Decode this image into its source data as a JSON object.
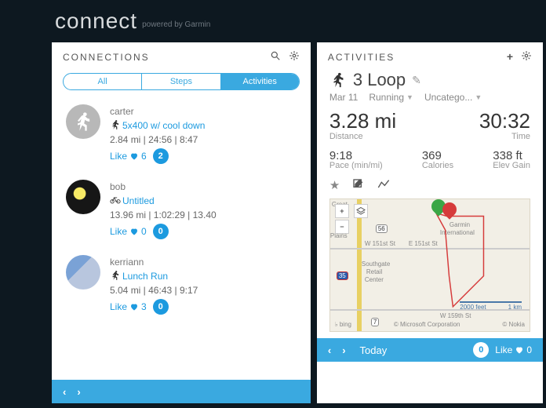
{
  "brand": {
    "logo": "connect",
    "powered": "powered by Garmin"
  },
  "left_panel": {
    "title": "CONNECTIONS",
    "tabs": {
      "all": "All",
      "steps": "Steps",
      "activities": "Activities",
      "active": "Activities"
    },
    "like_label": "Like",
    "items": [
      {
        "user": "carter",
        "icon": "run",
        "title": "5x400 w/ cool down",
        "meta": "2.84 mi | 24:56 | 8:47",
        "likes": "6",
        "comments": "2"
      },
      {
        "user": "bob",
        "icon": "bike",
        "title": "Untitled",
        "meta": "13.96 mi | 1:02:29 | 13.40",
        "likes": "0",
        "comments": "0"
      },
      {
        "user": "kerriann",
        "icon": "run",
        "title": "Lunch Run",
        "meta": "5.04 mi | 46:43 | 9:17",
        "likes": "3",
        "comments": "0"
      }
    ]
  },
  "right_panel": {
    "title": "ACTIVITIES",
    "activity": {
      "name": "3 Loop",
      "date": "Mar 11",
      "type": "Running",
      "category": "Uncatego...",
      "distance": {
        "value": "3.28 mi",
        "label": "Distance"
      },
      "time": {
        "value": "30:32",
        "label": "Time"
      },
      "pace": {
        "value": "9:18",
        "label": "Pace (min/mi)"
      },
      "calories": {
        "value": "369",
        "label": "Calories"
      },
      "elev": {
        "value": "338 ft",
        "label": "Elev Gain"
      }
    },
    "map": {
      "labels": {
        "great": "Great",
        "plains": "Plains",
        "w151": "W 151st St",
        "e151": "E 151st St",
        "garmin": "Garmin",
        "intl": "International",
        "southgate": "Southgate",
        "retail": "Retail",
        "center": "Center",
        "w159": "W 159th St"
      },
      "shield56": "56",
      "shield35": "35",
      "shield7": "7",
      "scale_ft": "2000 feet",
      "scale_km": "1 km",
      "bing": "bing",
      "msft": "© Microsoft Corporation",
      "nokia": "© Nokia"
    },
    "footer": {
      "today": "Today",
      "comments": "0",
      "like_label": "Like",
      "likes": "0"
    }
  }
}
